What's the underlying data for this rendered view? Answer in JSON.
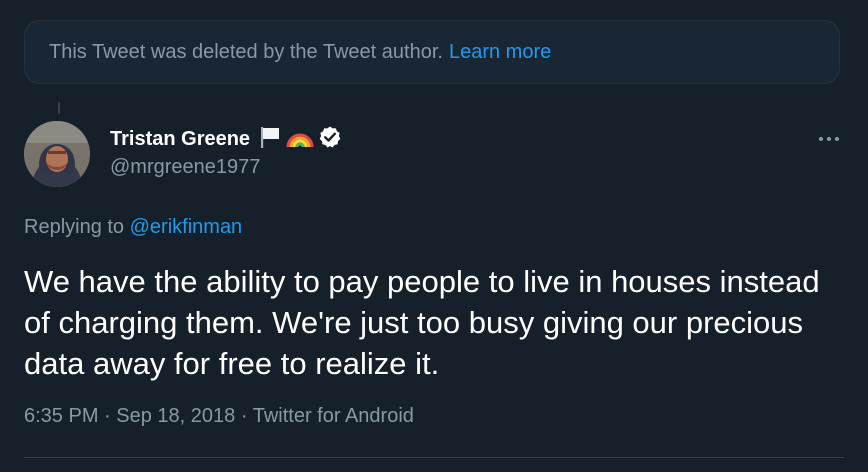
{
  "deleted_notice": {
    "text": "This Tweet was deleted by the Tweet author.",
    "learn_more": "Learn more"
  },
  "tweet": {
    "author": {
      "display_name": "Tristan Greene",
      "handle": "@mrgreene1977",
      "name_emojis": [
        "white-flag-emoji",
        "rainbow-emoji"
      ],
      "verified": true
    },
    "replying_to_label": "Replying to",
    "replying_to_handle": "@erikfinman",
    "text": "We have the ability to pay people to live in houses instead of charging them. We're just too busy giving our precious data away for free to realize it.",
    "time": "6:35 PM",
    "date": "Sep 18, 2018",
    "source": "Twitter for Android",
    "separator": "·"
  },
  "colors": {
    "background": "#15202b",
    "card_background": "#192734",
    "border": "#38444d",
    "secondary_text": "#8899a6",
    "accent": "#1d9bf0"
  }
}
